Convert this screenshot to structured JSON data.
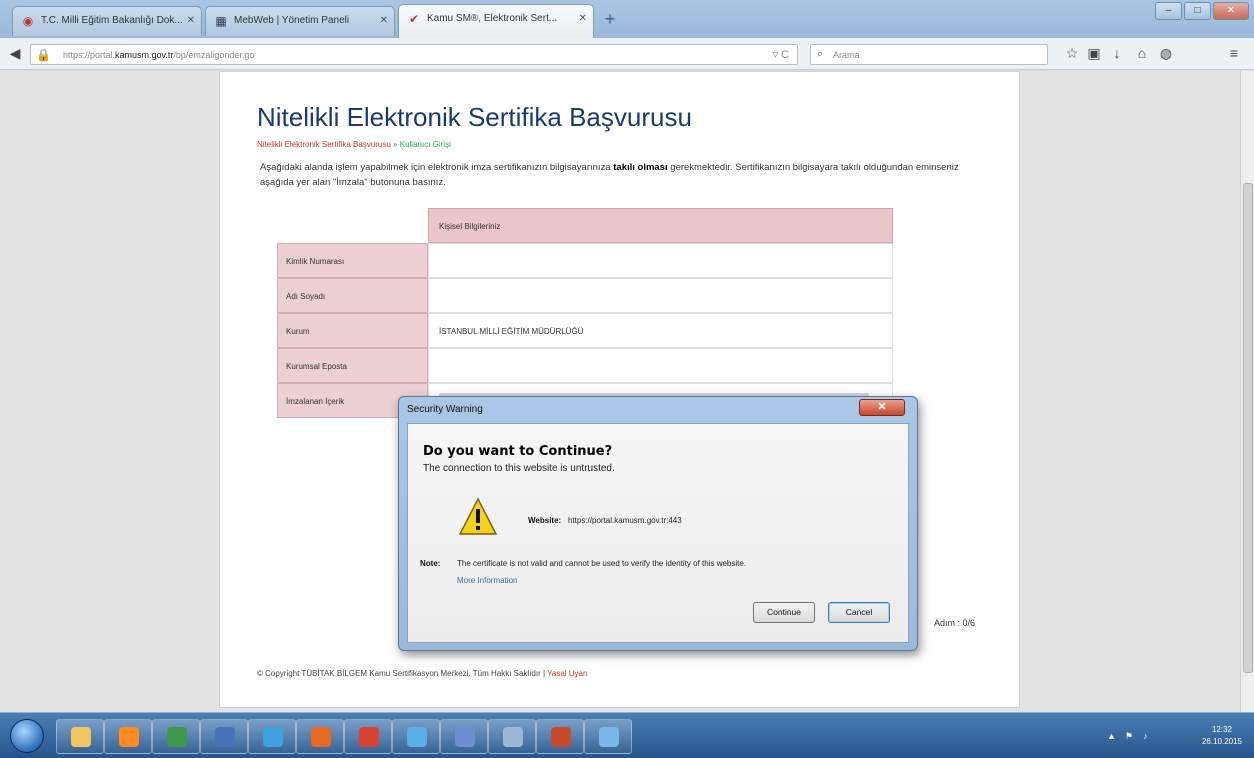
{
  "browser": {
    "tabs": [
      {
        "label": "T.C. Milli Eğitim Bakanlığı Dok...",
        "icon": "meb-icon",
        "active": false
      },
      {
        "label": "MebWeb | Yönetim Paneli",
        "icon": "grid-icon",
        "active": false
      },
      {
        "label": "Kamu SM®, Elektronik Sert...",
        "icon": "kamusm-icon",
        "active": true
      }
    ],
    "new_tab": "+",
    "window_controls": {
      "minimize": "–",
      "maximize": "□",
      "close": "✕"
    },
    "url_prefix": "https://portal.",
    "url_domain": "kamusm.gov.tr",
    "url_path": "/bp/emzaligonder.go",
    "url_controls": "▿ C",
    "search_placeholder": "Arama",
    "toolbar_icons": [
      "star-icon",
      "clipboard-icon",
      "download-icon",
      "home-icon",
      "pocket-icon",
      "menu-icon"
    ]
  },
  "page": {
    "title": "Nitelikli Elektronik Sertifika Başvurusu",
    "breadcrumb": {
      "first": "Nitelikli Elektronik Sertifika Başvurusu",
      "sep": " » ",
      "current": "Kullanıcı Girişi"
    },
    "intro_pre": "Aşağıdaki alanda işlem yapabilmek için elektronik imza sertifikanızın bilgisayarınıza ",
    "intro_bold": "takılı olması",
    "intro_post": " gerekmektedir. Sertifikanızın bilgisayara takılı olduğundan eminseniz aşağıda yer alan \"İmzala\" butonuna basınız.",
    "table_header": "Kişisel Bilgileriniz",
    "rows": [
      {
        "label": "Kimlik Numarası",
        "value": ""
      },
      {
        "label": "Adı Soyadı",
        "value": ""
      },
      {
        "label": "Kurum",
        "value": "İSTANBUL MİLLİ EĞİTİM MÜDÜRLÜĞÜ"
      },
      {
        "label": "Kurumsal Eposta",
        "value": ""
      },
      {
        "label": "İmzalanan İçerik",
        "value": ""
      }
    ],
    "step": "Adım : 0/6",
    "copyright": "© Copyright TÜBİTAK BİLGEM Kamu Sertifikasyon Merkezi. Tüm Hakkı Saklıdır | ",
    "legal": "Yasal Uyarı"
  },
  "dialog": {
    "title": "Security Warning",
    "close": "✕",
    "heading": "Do you want to Continue?",
    "subtitle": "The connection to this website is untrusted.",
    "website_label": "Website:",
    "website_value": "https://portal.kamusm.gov.tr:443",
    "note_label": "Note:",
    "note_text": "The certificate is not valid and cannot be used to verify the identity of this website.",
    "more_info": "More Information",
    "continue": "Continue",
    "cancel": "Cancel"
  },
  "taskbar": {
    "time": "12:32",
    "date": "26.10.2015",
    "items": [
      "explorer-icon",
      "media-player-icon",
      "excel-icon",
      "project-icon",
      "ie-icon",
      "firefox-icon",
      "chrome-icon",
      "tubitak-icon",
      "network-icon",
      "calculator-icon",
      "java-icon",
      "paint-icon"
    ],
    "item_colors": [
      "#f0c75e",
      "#ff8a1e",
      "#3e9a4a",
      "#4a72b8",
      "#3da2e0",
      "#e86a1e",
      "#d9432f",
      "#5ab0e6",
      "#6f8fd0",
      "#9bb8d8",
      "#c84a2a",
      "#7ab8e8"
    ],
    "tray": [
      "▲",
      "⚑",
      "♪"
    ]
  }
}
